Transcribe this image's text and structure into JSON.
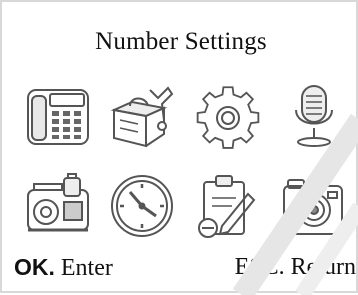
{
  "screen": {
    "title": "Number Settings"
  },
  "menu_icons": [
    {
      "icon": "desk-phone-icon"
    },
    {
      "icon": "toolbox-icon"
    },
    {
      "icon": "gear-icon"
    },
    {
      "icon": "microphone-icon"
    },
    {
      "icon": "safe-icon"
    },
    {
      "icon": "clock-icon"
    },
    {
      "icon": "clipboard-edit-icon"
    },
    {
      "icon": "camera-icon"
    }
  ],
  "footer": {
    "ok_key": "OK.",
    "ok_action": "Enter",
    "esc_hint": "ESC. Return"
  },
  "colors": {
    "icon_stroke": "#555555",
    "border": "#d8d8d8",
    "watermark": "#e6e6e6"
  }
}
